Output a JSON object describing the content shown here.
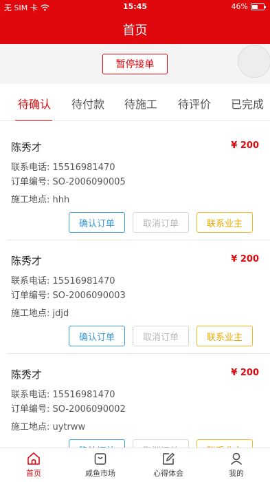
{
  "status_bar": {
    "carrier": "无 SIM 卡",
    "time": "15:45",
    "battery": "46%"
  },
  "nav": {
    "title": "首页"
  },
  "pause_button": "暂停接单",
  "tabs": [
    "待确认",
    "待付款",
    "待施工",
    "待评价",
    "已完成"
  ],
  "active_tab_index": 0,
  "labels": {
    "phone": "联系电话:",
    "order_no": "订单编号:",
    "location": "施工地点:"
  },
  "buttons": {
    "confirm": "确认订单",
    "cancel": "取消订单",
    "contact": "联系业主"
  },
  "orders": [
    {
      "name": "陈秀才",
      "price": "¥ 200",
      "phone": "15516981470",
      "order_no": "SO-2006090005",
      "location": "hhh"
    },
    {
      "name": "陈秀才",
      "price": "¥ 200",
      "phone": "15516981470",
      "order_no": "SO-2006090003",
      "location": "jdjd"
    },
    {
      "name": "陈秀才",
      "price": "¥ 200",
      "phone": "15516981470",
      "order_no": "SO-2006090002",
      "location": "uytrww"
    }
  ],
  "tabbar": [
    {
      "label": "首页",
      "icon": "home-icon",
      "active": true
    },
    {
      "label": "咸鱼市场",
      "icon": "shopping-bag-icon",
      "active": false
    },
    {
      "label": "心得体会",
      "icon": "edit-note-icon",
      "active": false
    },
    {
      "label": "我的",
      "icon": "user-icon",
      "active": false
    }
  ],
  "colors": {
    "brand_red": "#e0080d",
    "confirm_blue": "#3a9bd6",
    "contact_yellow": "#f0a900",
    "disabled_gray": "#b8b8b8"
  }
}
